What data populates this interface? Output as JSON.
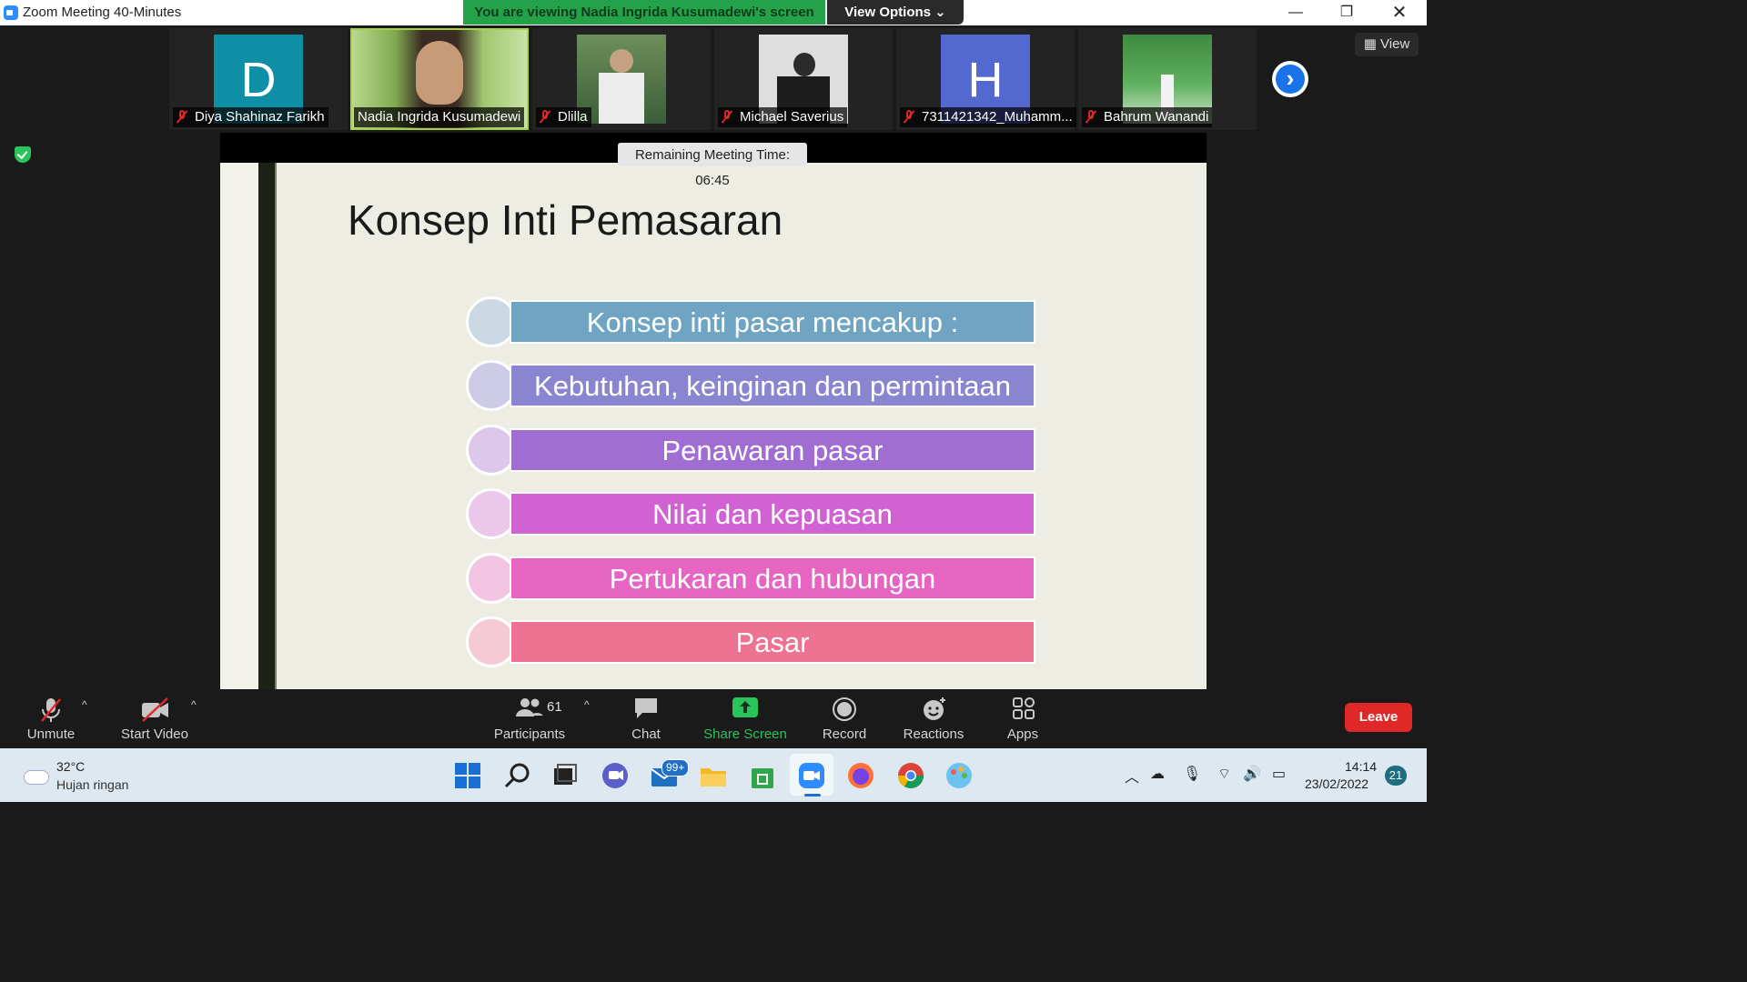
{
  "window": {
    "title": "Zoom Meeting 40-Minutes",
    "viewing_banner": "You are viewing Nadia Ingrida Kusumadewi's screen",
    "view_options": "View Options ⌄"
  },
  "gallery": {
    "view_label": "View",
    "participants": [
      {
        "name": "Diya Shahinaz Farikh",
        "avatar_letter": "D",
        "avatar_color": "#0e8fa6",
        "muted": true
      },
      {
        "name": "Nadia Ingrida Kusumadewi",
        "avatar_letter": "",
        "avatar_color": "#8fb05a",
        "muted": false,
        "active": true
      },
      {
        "name": "Dlilla",
        "avatar_letter": "",
        "avatar_color": "#6e8f5a",
        "muted": true
      },
      {
        "name": "Michael Saverius",
        "avatar_letter": "",
        "avatar_color": "#d9d9d9",
        "muted": true
      },
      {
        "name": "7311421342_Muhamm...",
        "avatar_letter": "H",
        "avatar_color": "#5469cf",
        "muted": true
      },
      {
        "name": "Bahrum Wanandi",
        "avatar_letter": "",
        "avatar_color": "#4a9a4a",
        "muted": true
      }
    ]
  },
  "meeting": {
    "remaining_time": "Remaining Meeting Time: 06:45"
  },
  "slide": {
    "title": "Konsep Inti Pemasaran",
    "items": [
      {
        "text": "Konsep inti pasar mencakup :",
        "bar_color": "#6fa5c2",
        "circle_color": "#c9d8e3"
      },
      {
        "text": "Kebutuhan, keinginan dan permintaan",
        "bar_color": "#8a85d0",
        "circle_color": "#cecbe8"
      },
      {
        "text": "Penawaran pasar",
        "bar_color": "#a06ed2",
        "circle_color": "#ddc8ec"
      },
      {
        "text": "Nilai dan kepuasan",
        "bar_color": "#d162d2",
        "circle_color": "#ecc7ec"
      },
      {
        "text": "Pertukaran dan hubungan",
        "bar_color": "#e665c2",
        "circle_color": "#f2c6e2"
      },
      {
        "text": "Pasar",
        "bar_color": "#ee7291",
        "circle_color": "#f6cad4"
      }
    ]
  },
  "toolbar": {
    "unmute": "Unmute",
    "start_video": "Start Video",
    "participants": "Participants",
    "participant_count": "61",
    "chat": "Chat",
    "share_screen": "Share Screen",
    "record": "Record",
    "reactions": "Reactions",
    "apps": "Apps",
    "leave": "Leave"
  },
  "taskbar": {
    "weather_temp": "32°C",
    "weather_desc": "Hujan ringan",
    "mail_badge": "99+",
    "time": "14:14",
    "date": "23/02/2022",
    "notification_count": "21"
  }
}
